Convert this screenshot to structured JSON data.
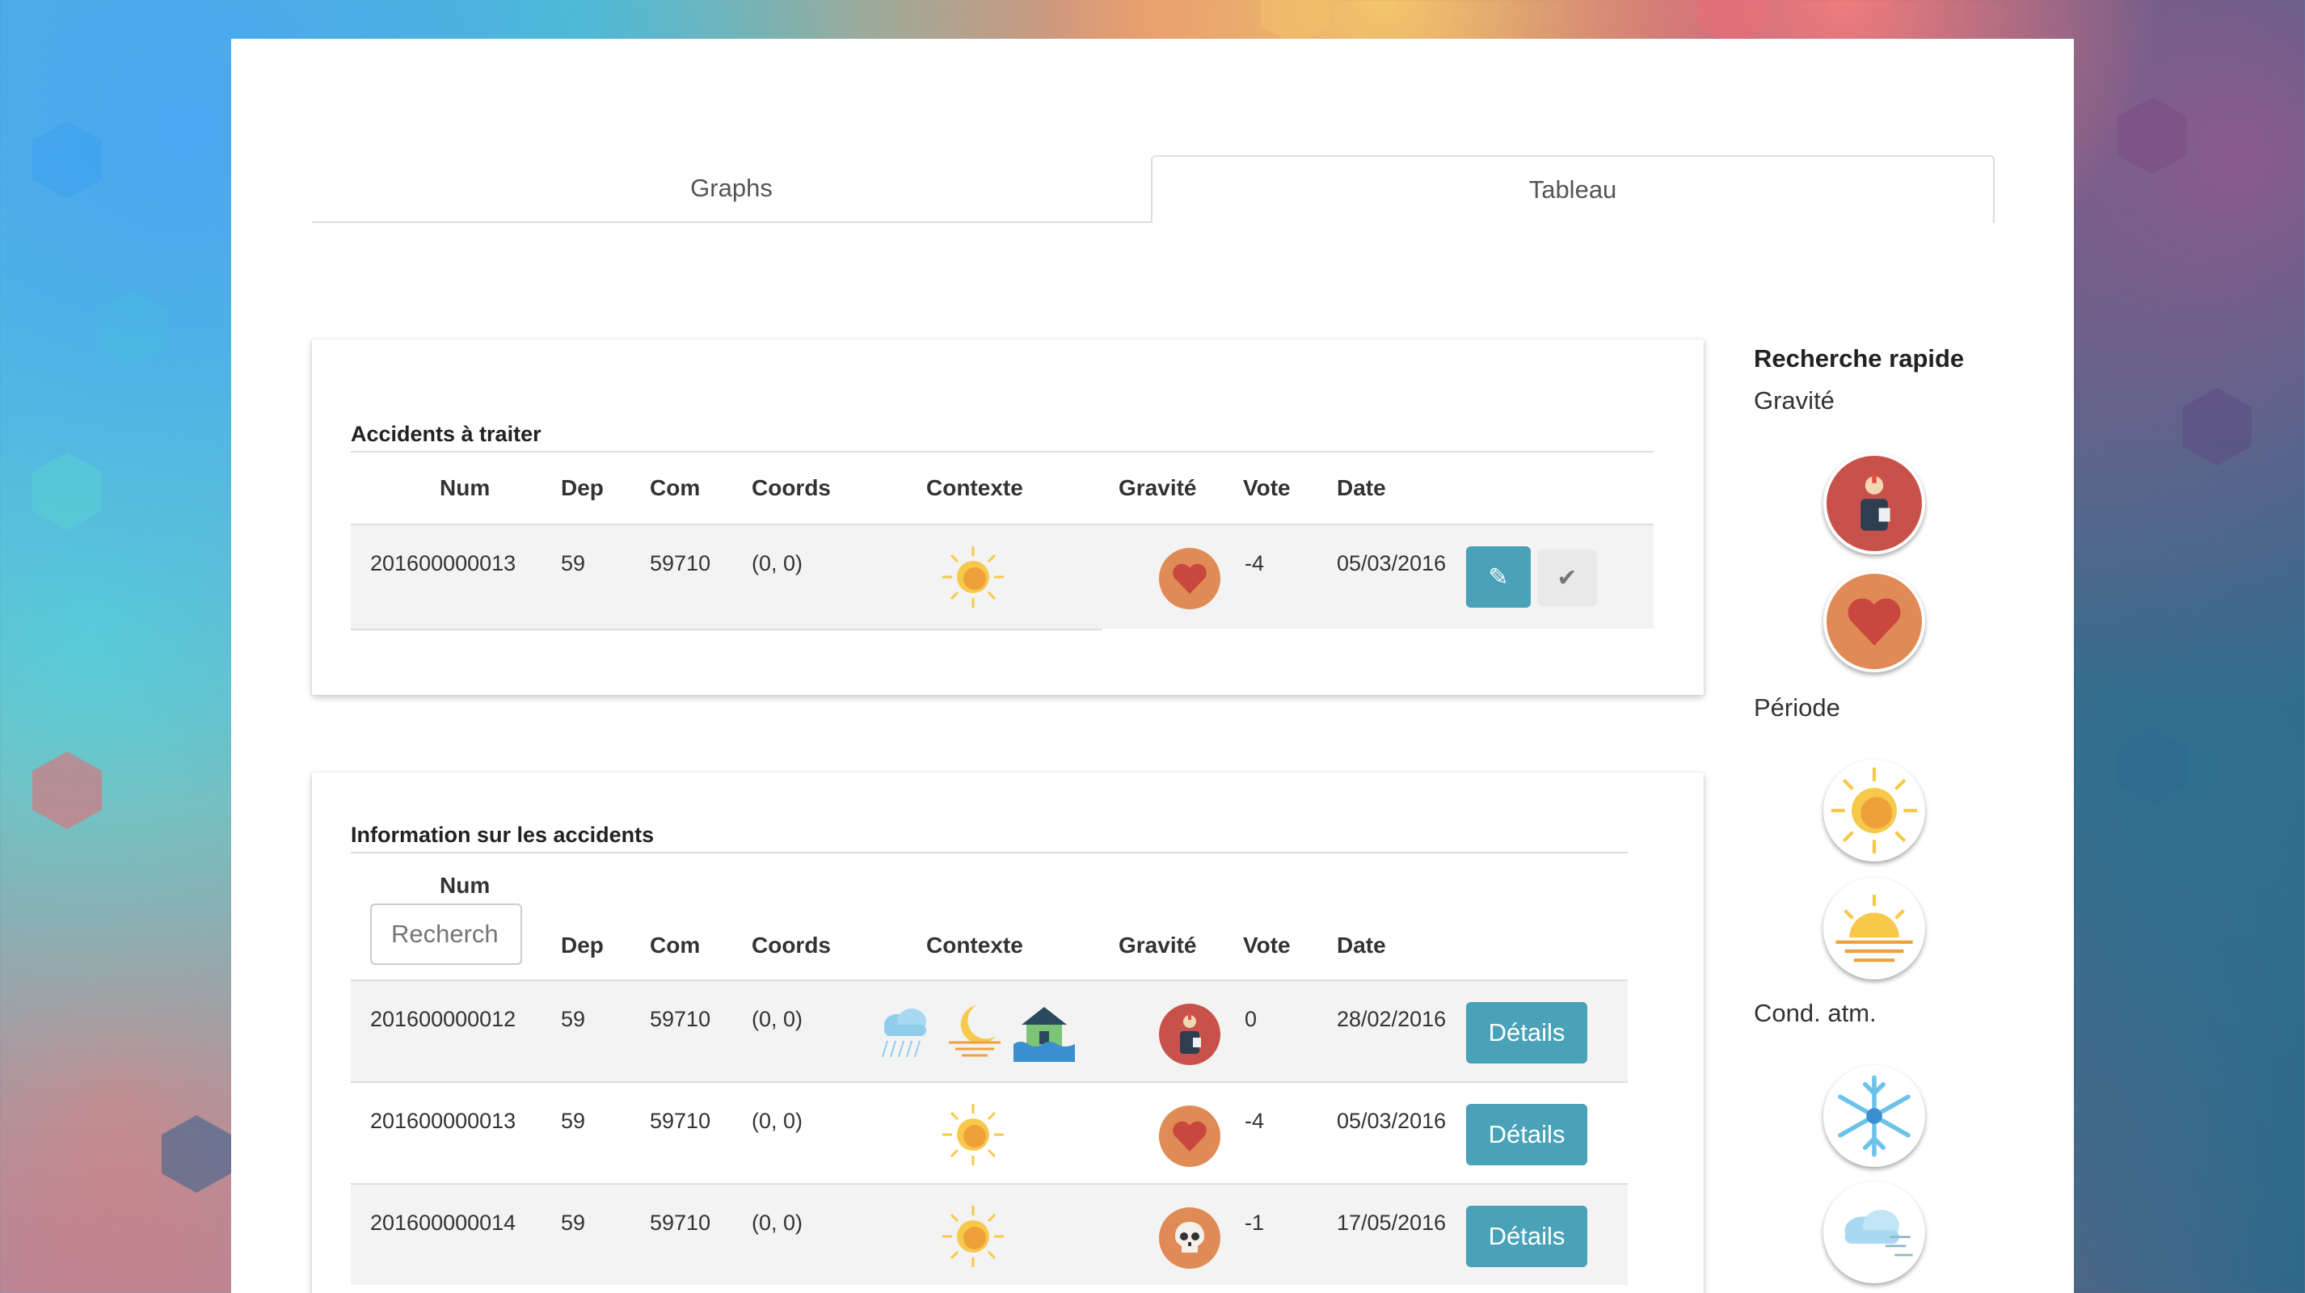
{
  "tabs": {
    "graphs": "Graphs",
    "tableau": "Tableau"
  },
  "pending": {
    "title": "Accidents à traiter",
    "headers": {
      "num": "Num",
      "dep": "Dep",
      "com": "Com",
      "coords": "Coords",
      "contexte": "Contexte",
      "gravite": "Gravité",
      "vote": "Vote",
      "date": "Date"
    },
    "row": {
      "num": "201600000013",
      "dep": "59",
      "com": "59710",
      "coords": "(0, 0)",
      "context_icons": [
        "sun-icon"
      ],
      "gravity_icon": "heart-icon",
      "vote": "-4",
      "date": "05/03/2016"
    }
  },
  "info": {
    "title": "Information sur les accidents",
    "headers": {
      "num": "Num",
      "dep": "Dep",
      "com": "Com",
      "coords": "Coords",
      "contexte": "Contexte",
      "gravite": "Gravité",
      "vote": "Vote",
      "date": "Date"
    },
    "search_placeholder": "Recherch",
    "details_label": "Détails",
    "rows": [
      {
        "num": "201600000012",
        "dep": "59",
        "com": "59710",
        "coords": "(0, 0)",
        "context_icons": [
          "rain-cloud-icon",
          "moon-sunset-icon",
          "flooded-house-icon"
        ],
        "gravity_icon": "injured-person-icon",
        "vote": "0",
        "date": "28/02/2016"
      },
      {
        "num": "201600000013",
        "dep": "59",
        "com": "59710",
        "coords": "(0, 0)",
        "context_icons": [
          "sun-icon"
        ],
        "gravity_icon": "heart-icon",
        "vote": "-4",
        "date": "05/03/2016"
      },
      {
        "num": "201600000014",
        "dep": "59",
        "com": "59710",
        "coords": "(0, 0)",
        "context_icons": [
          "sun-icon"
        ],
        "gravity_icon": "skull-icon",
        "vote": "-1",
        "date": "17/05/2016"
      }
    ]
  },
  "sidebar": {
    "title": "Recherche rapide",
    "gravite": "Gravité",
    "periode": "Période",
    "cond_atm": "Cond. atm.",
    "gravity_icons": [
      "injured-person-icon",
      "heart-icon"
    ],
    "period_icons": [
      "sun-icon",
      "sunset-icon"
    ],
    "weather_icons": [
      "snowflake-icon",
      "wind-cloud-icon"
    ]
  },
  "colors": {
    "accent": "#4aa2b8",
    "injured": "#c9514b",
    "heart": "#e08a55"
  }
}
